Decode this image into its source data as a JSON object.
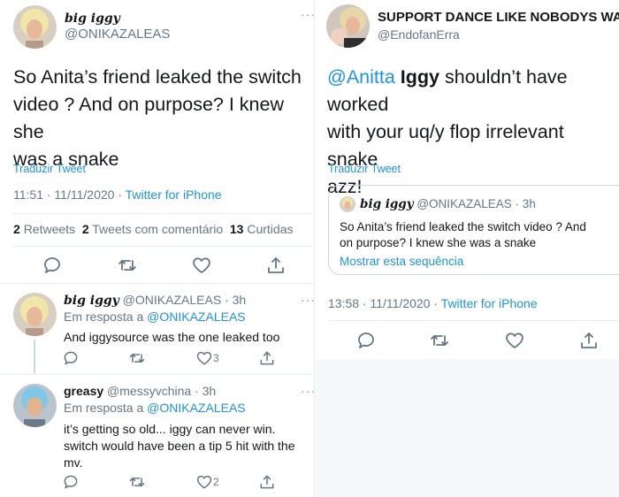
{
  "left": {
    "main_tweet": {
      "display_name": "big iggy",
      "handle": "@ONIKAZALEAS",
      "more": "···",
      "text_lines": [
        "So Anita’s friend leaked the switch",
        "video ? And on purpose? I knew she",
        "was a snake"
      ],
      "translate": "Traduzir Tweet",
      "time": "11:51 · 11/11/2020 ·",
      "source": "Twitter for iPhone",
      "stats": {
        "retweets_count": "2",
        "retweets_label": "Retweets",
        "quotes_count": "2",
        "quotes_label": "Tweets com comentário",
        "likes_count": "13",
        "likes_label": "Curtidas"
      }
    },
    "reply1": {
      "display_name": "big iggy",
      "handle_time": "@ONIKAZALEAS · 3h",
      "more": "···",
      "replying_prefix": "Em resposta a",
      "replying_to": "@ONIKAZALEAS",
      "text": "And iggysource was the one leaked too",
      "like_count": "3"
    },
    "reply2": {
      "display_name": "greasy",
      "handle_time": "@messyvchina · 3h",
      "more": "···",
      "replying_prefix": "Em resposta a",
      "replying_to": "@ONIKAZALEAS",
      "text_lines": [
        "it’s getting so old... iggy can never win.",
        "switch would have been a tip 5 hit with the",
        "mv."
      ],
      "like_count": "2"
    }
  },
  "right": {
    "tweet": {
      "display_name": "SUPPORT DANCE LIKE NOBODYS WA...",
      "handle": "@EndofanErra",
      "more": "···",
      "mention": "@Anitta",
      "bold_word": "Iggy",
      "line1_rest": "shouldn’t have worked",
      "line2": "with your uq/y flop irrelevant snake",
      "line3": "azz!",
      "translate": "Traduzir Tweet",
      "time": "13:58 · 11/11/2020 ·",
      "source": "Twitter for iPhone"
    },
    "quote": {
      "display_name": "big iggy",
      "handle_time": "@ONIKAZALEAS · 3h",
      "text_lines": [
        "So Anita’s friend leaked the switch video ? And",
        "on purpose? I knew she was a snake"
      ],
      "show_thread": "Mostrar esta sequência"
    }
  },
  "colors": {
    "link": "#1b95e0",
    "muted": "#657786",
    "text": "#14171a",
    "divider": "#e6ecf0",
    "icon": "#657786"
  }
}
